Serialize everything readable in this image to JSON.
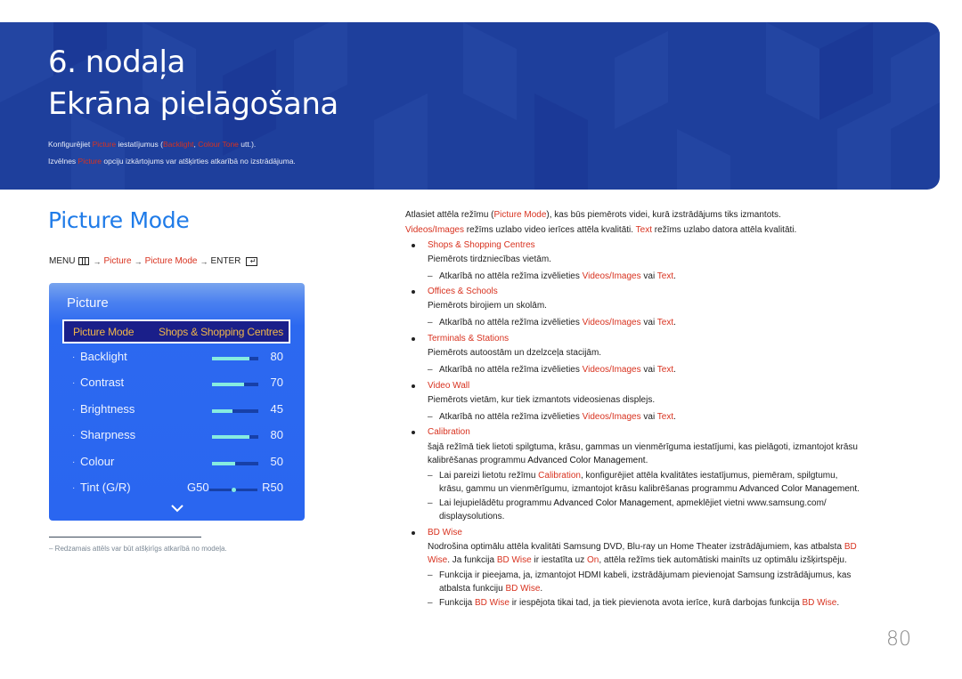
{
  "banner": {
    "chapter": "6. nodaļa",
    "title": "Ekrāna pielāgošana",
    "desc_line1": [
      {
        "text": "Konfigurējiet ",
        "hl": false
      },
      {
        "text": "Picture",
        "hl": true
      },
      {
        "text": " iestatījumus (",
        "hl": false
      },
      {
        "text": "Backlight",
        "hl": true
      },
      {
        "text": ", ",
        "hl": false
      },
      {
        "text": "Colour Tone",
        "hl": true
      },
      {
        "text": " utt.).",
        "hl": false
      }
    ],
    "desc_line2": [
      {
        "text": "Izvēlnes ",
        "hl": false
      },
      {
        "text": "Picture",
        "hl": true
      },
      {
        "text": " opciju izkārtojums var atšķirties atkarībā no izstrādājuma.",
        "hl": false
      }
    ]
  },
  "section": {
    "title": "Picture Mode",
    "menu_path": {
      "menu": "MENU",
      "step1": "Picture",
      "step2": "Picture Mode",
      "enter": "ENTER",
      "arrow": "→"
    }
  },
  "panel": {
    "title": "Picture",
    "mode_label": "Picture Mode",
    "mode_value": "Shops & Shopping Centres",
    "settings": [
      {
        "label": "Backlight",
        "value": "80",
        "percent": 80
      },
      {
        "label": "Contrast",
        "value": "70",
        "percent": 70
      },
      {
        "label": "Brightness",
        "value": "45",
        "percent": 45
      },
      {
        "label": "Sharpness",
        "value": "80",
        "percent": 80
      },
      {
        "label": "Colour",
        "value": "50",
        "percent": 50
      }
    ],
    "tint": {
      "label": "Tint (G/R)",
      "left": "G50",
      "right": "R50",
      "position_percent": 50
    },
    "more_icon": "chevron-down-icon"
  },
  "footnote": "–  Redzamais attēls var būt atšķirīgs atkarībā no modeļa.",
  "content": {
    "intro1": [
      {
        "text": "Atlasiet attēla režīmu (",
        "s": "n"
      },
      {
        "text": "Picture Mode",
        "s": "r"
      },
      {
        "text": "), kas būs piemērots videi, kurā izstrādājums tiks izmantots.",
        "s": "n"
      }
    ],
    "intro2": [
      {
        "text": "Videos/Images",
        "s": "r"
      },
      {
        "text": " režīms uzlabo video ierīces attēla kvalitāti. ",
        "s": "n"
      },
      {
        "text": "Text",
        "s": "r"
      },
      {
        "text": " režīms uzlabo datora attēla kvalitāti.",
        "s": "n"
      }
    ],
    "modes": [
      {
        "name": "Shops & Shopping Centres",
        "desc": "Piemērots tirdzniecības vietām.",
        "note": [
          {
            "text": "Atkarībā no attēla režīma izvēlieties ",
            "s": "n"
          },
          {
            "text": "Videos/Images",
            "s": "r"
          },
          {
            "text": " vai ",
            "s": "n"
          },
          {
            "text": "Text",
            "s": "r"
          },
          {
            "text": ".",
            "s": "n"
          }
        ]
      },
      {
        "name": "Offices & Schools",
        "desc": "Piemērots birojiem un skolām.",
        "note": [
          {
            "text": "Atkarībā no attēla režīma izvēlieties ",
            "s": "n"
          },
          {
            "text": "Videos/Images",
            "s": "r"
          },
          {
            "text": " vai ",
            "s": "n"
          },
          {
            "text": "Text",
            "s": "r"
          },
          {
            "text": ".",
            "s": "n"
          }
        ]
      },
      {
        "name": "Terminals & Stations",
        "desc": "Piemērots autoostām un dzelzceļa stacijām.",
        "note": [
          {
            "text": "Atkarībā no attēla režīma izvēlieties ",
            "s": "n"
          },
          {
            "text": "Videos/Images",
            "s": "r"
          },
          {
            "text": " vai ",
            "s": "n"
          },
          {
            "text": "Text",
            "s": "r"
          },
          {
            "text": ".",
            "s": "n"
          }
        ]
      },
      {
        "name": "Video Wall",
        "desc": "Piemērots vietām, kur tiek izmantots videosienas displejs.",
        "note": [
          {
            "text": "Atkarībā no attēla režīma izvēlieties ",
            "s": "n"
          },
          {
            "text": "Videos/Images",
            "s": "r"
          },
          {
            "text": " vai ",
            "s": "n"
          },
          {
            "text": "Text",
            "s": "r"
          },
          {
            "text": ".",
            "s": "n"
          }
        ]
      }
    ],
    "calibration": {
      "name": "Calibration",
      "desc1": [
        {
          "text": "šajā režīmā tiek lietoti spilgtuma, krāsu, gammas un vienmērīguma iestatījumi, kas pielāgoti, izmantojot krāsu",
          "s": "n"
        }
      ],
      "desc2": [
        {
          "text": "kalibrēšanas programmu ",
          "s": "n"
        },
        {
          "text": "Advanced Color Management",
          "s": "b"
        },
        {
          "text": ".",
          "s": "n"
        }
      ],
      "note1a": [
        {
          "text": "Lai pareizi lietotu režīmu ",
          "s": "n"
        },
        {
          "text": "Calibration",
          "s": "r"
        },
        {
          "text": ", konfigurējiet attēla kvalitātes iestatījumus, piemēram, spilgtumu,",
          "s": "n"
        }
      ],
      "note1b": [
        {
          "text": "krāsu, gammu un vienmērīgumu, izmantojot krāsu kalibrēšanas programmu ",
          "s": "n"
        },
        {
          "text": "Advanced Color Management",
          "s": "b"
        },
        {
          "text": ".",
          "s": "n"
        }
      ],
      "note2a": [
        {
          "text": "Lai lejupielādētu programmu ",
          "s": "n"
        },
        {
          "text": "Advanced Color Management",
          "s": "b"
        },
        {
          "text": ", apmeklējiet vietni www.samsung.com/",
          "s": "n"
        }
      ],
      "note2b": [
        {
          "text": "displaysolutions.",
          "s": "n"
        }
      ]
    },
    "bdwise": {
      "name": "BD Wise",
      "desc1": [
        {
          "text": "Nodrošina optimālu attēla kvalitāti Samsung DVD, Blu-ray un Home Theater izstrādājumiem, kas atbalsta ",
          "s": "n"
        },
        {
          "text": "BD",
          "s": "r"
        }
      ],
      "desc2": [
        {
          "text": "Wise",
          "s": "r"
        },
        {
          "text": ". Ja funkcija ",
          "s": "n"
        },
        {
          "text": "BD Wise",
          "s": "r"
        },
        {
          "text": " ir iestatīta uz ",
          "s": "n"
        },
        {
          "text": "On",
          "s": "r"
        },
        {
          "text": ", attēla režīms tiek automātiski mainīts uz optimālu izšķirtspēju.",
          "s": "n"
        }
      ],
      "note1a": [
        {
          "text": "Funkcija ir pieejama, ja, izmantojot HDMI kabeli, izstrādājumam pievienojat Samsung izstrādājumus, kas",
          "s": "n"
        }
      ],
      "note1b": [
        {
          "text": "atbalsta funkciju ",
          "s": "n"
        },
        {
          "text": "BD Wise",
          "s": "r"
        },
        {
          "text": ".",
          "s": "n"
        }
      ],
      "note2": [
        {
          "text": "Funkcija ",
          "s": "n"
        },
        {
          "text": "BD Wise",
          "s": "r"
        },
        {
          "text": " ir iespējota tikai tad, ja tiek pievienota avota ierīce, kurā darbojas funkcija ",
          "s": "n"
        },
        {
          "text": "BD Wise",
          "s": "r"
        },
        {
          "text": ".",
          "s": "n"
        }
      ]
    }
  },
  "page_number": "80",
  "colors": {
    "banner": "#1e3f9c",
    "accent_blue": "#1f7be8",
    "highlight_red": "#d8321f",
    "panel_blue": "#2a66f0",
    "mode_row": "#1a1f8a",
    "mode_text": "#f0b64a",
    "slider_fill": "#86ece0",
    "slider_track": "#1740a8"
  }
}
